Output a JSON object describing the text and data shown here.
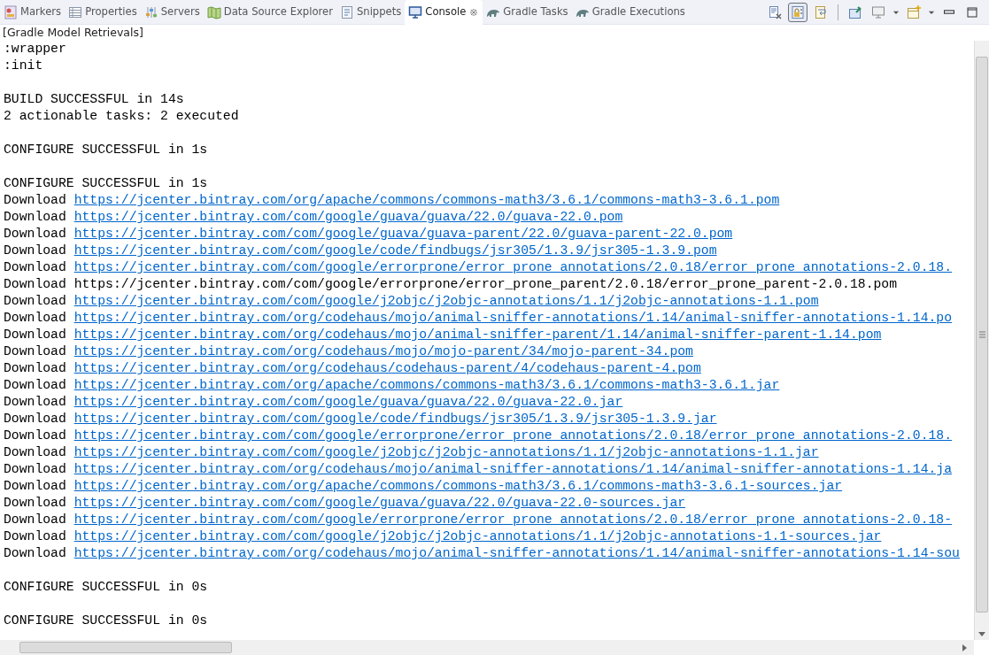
{
  "tabs": [
    {
      "label": "Markers",
      "selected": false,
      "closable": false
    },
    {
      "label": "Properties",
      "selected": false,
      "closable": false
    },
    {
      "label": "Servers",
      "selected": false,
      "closable": false
    },
    {
      "label": "Data Source Explorer",
      "selected": false,
      "closable": false
    },
    {
      "label": "Snippets",
      "selected": false,
      "closable": false
    },
    {
      "label": "Console",
      "selected": true,
      "closable": true
    },
    {
      "label": "Gradle Tasks",
      "selected": false,
      "closable": false
    },
    {
      "label": "Gradle Executions",
      "selected": false,
      "closable": false
    }
  ],
  "toolbar": [
    {
      "kind": "clear",
      "pressed": false
    },
    {
      "kind": "scroll-lock",
      "pressed": true
    },
    {
      "kind": "word-wrap",
      "pressed": false
    },
    {
      "kind": "separator"
    },
    {
      "kind": "pin",
      "pressed": false
    },
    {
      "kind": "display",
      "pressed": false,
      "dropdown": true
    },
    {
      "kind": "new-console",
      "pressed": false,
      "dropdown": true
    },
    {
      "kind": "minimize",
      "pressed": false
    },
    {
      "kind": "maximize",
      "pressed": false
    }
  ],
  "console_title": "[Gradle Model Retrievals]",
  "lines": [
    {
      "kind": "text",
      "text": ":wrapper"
    },
    {
      "kind": "text",
      "text": ":init"
    },
    {
      "kind": "blank"
    },
    {
      "kind": "text",
      "text": "BUILD SUCCESSFUL in 14s"
    },
    {
      "kind": "text",
      "text": "2 actionable tasks: 2 executed"
    },
    {
      "kind": "blank"
    },
    {
      "kind": "text",
      "text": "CONFIGURE SUCCESSFUL in 1s"
    },
    {
      "kind": "blank"
    },
    {
      "kind": "text",
      "text": "CONFIGURE SUCCESSFUL in 1s"
    },
    {
      "kind": "download",
      "text": "Download",
      "url": "https://jcenter.bintray.com/org/apache/commons/commons-math3/3.6.1/commons-math3-3.6.1.pom",
      "linked": true
    },
    {
      "kind": "download",
      "text": "Download",
      "url": "https://jcenter.bintray.com/com/google/guava/guava/22.0/guava-22.0.pom",
      "linked": true
    },
    {
      "kind": "download",
      "text": "Download",
      "url": "https://jcenter.bintray.com/com/google/guava/guava-parent/22.0/guava-parent-22.0.pom",
      "linked": true
    },
    {
      "kind": "download",
      "text": "Download",
      "url": "https://jcenter.bintray.com/com/google/code/findbugs/jsr305/1.3.9/jsr305-1.3.9.pom",
      "linked": true
    },
    {
      "kind": "download",
      "text": "Download",
      "url": "https://jcenter.bintray.com/com/google/errorprone/error_prone_annotations/2.0.18/error_prone_annotations-2.0.18.",
      "linked": true
    },
    {
      "kind": "download",
      "text": "Download",
      "url": "https://jcenter.bintray.com/com/google/errorprone/error_prone_parent/2.0.18/error_prone_parent-2.0.18.pom",
      "linked": false
    },
    {
      "kind": "download",
      "text": "Download",
      "url": "https://jcenter.bintray.com/com/google/j2objc/j2objc-annotations/1.1/j2objc-annotations-1.1.pom",
      "linked": true
    },
    {
      "kind": "download",
      "text": "Download",
      "url": "https://jcenter.bintray.com/org/codehaus/mojo/animal-sniffer-annotations/1.14/animal-sniffer-annotations-1.14.po",
      "linked": true
    },
    {
      "kind": "download",
      "text": "Download",
      "url": "https://jcenter.bintray.com/org/codehaus/mojo/animal-sniffer-parent/1.14/animal-sniffer-parent-1.14.pom",
      "linked": true
    },
    {
      "kind": "download",
      "text": "Download",
      "url": "https://jcenter.bintray.com/org/codehaus/mojo/mojo-parent/34/mojo-parent-34.pom",
      "linked": true
    },
    {
      "kind": "download",
      "text": "Download",
      "url": "https://jcenter.bintray.com/org/codehaus/codehaus-parent/4/codehaus-parent-4.pom",
      "linked": true
    },
    {
      "kind": "download",
      "text": "Download",
      "url": "https://jcenter.bintray.com/org/apache/commons/commons-math3/3.6.1/commons-math3-3.6.1.jar",
      "linked": true
    },
    {
      "kind": "download",
      "text": "Download",
      "url": "https://jcenter.bintray.com/com/google/guava/guava/22.0/guava-22.0.jar",
      "linked": true
    },
    {
      "kind": "download",
      "text": "Download",
      "url": "https://jcenter.bintray.com/com/google/code/findbugs/jsr305/1.3.9/jsr305-1.3.9.jar",
      "linked": true
    },
    {
      "kind": "download",
      "text": "Download",
      "url": "https://jcenter.bintray.com/com/google/errorprone/error_prone_annotations/2.0.18/error_prone_annotations-2.0.18.",
      "linked": true
    },
    {
      "kind": "download",
      "text": "Download",
      "url": "https://jcenter.bintray.com/com/google/j2objc/j2objc-annotations/1.1/j2objc-annotations-1.1.jar",
      "linked": true
    },
    {
      "kind": "download",
      "text": "Download",
      "url": "https://jcenter.bintray.com/org/codehaus/mojo/animal-sniffer-annotations/1.14/animal-sniffer-annotations-1.14.ja",
      "linked": true
    },
    {
      "kind": "download",
      "text": "Download",
      "url": "https://jcenter.bintray.com/org/apache/commons/commons-math3/3.6.1/commons-math3-3.6.1-sources.jar",
      "linked": true
    },
    {
      "kind": "download",
      "text": "Download",
      "url": "https://jcenter.bintray.com/com/google/guava/guava/22.0/guava-22.0-sources.jar",
      "linked": true
    },
    {
      "kind": "download",
      "text": "Download",
      "url": "https://jcenter.bintray.com/com/google/errorprone/error_prone_annotations/2.0.18/error_prone_annotations-2.0.18-",
      "linked": true
    },
    {
      "kind": "download",
      "text": "Download",
      "url": "https://jcenter.bintray.com/com/google/j2objc/j2objc-annotations/1.1/j2objc-annotations-1.1-sources.jar",
      "linked": true
    },
    {
      "kind": "download",
      "text": "Download",
      "url": "https://jcenter.bintray.com/org/codehaus/mojo/animal-sniffer-annotations/1.14/animal-sniffer-annotations-1.14-sou",
      "linked": true
    },
    {
      "kind": "blank"
    },
    {
      "kind": "text",
      "text": "CONFIGURE SUCCESSFUL in 0s"
    },
    {
      "kind": "blank"
    },
    {
      "kind": "text",
      "text": "CONFIGURE SUCCESSFUL in 0s"
    }
  ]
}
